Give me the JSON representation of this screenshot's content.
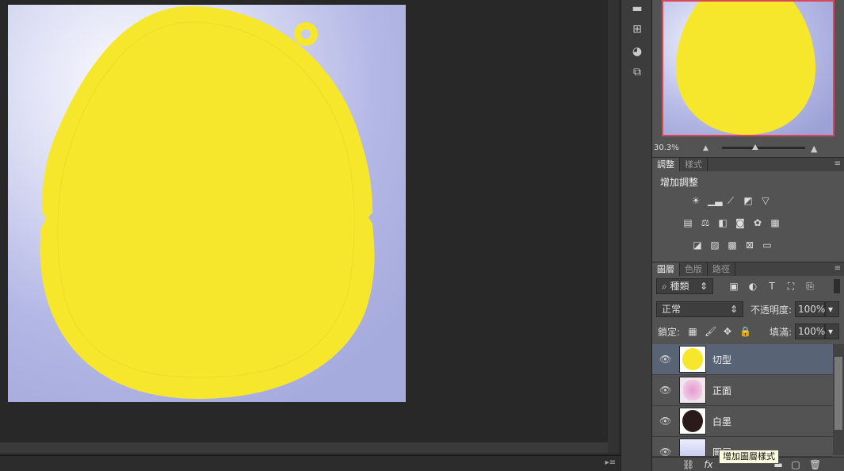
{
  "document": {
    "bg_color": "#b4b8e6",
    "shape_color": "#f6e72c"
  },
  "navigator": {
    "zoom": "30.3%",
    "frame_color": "#d9475a"
  },
  "adjustments": {
    "tabs": [
      "調整",
      "樣式"
    ],
    "title": "增加調整",
    "row1": [
      "brightness-icon",
      "levels-icon",
      "curves-icon",
      "exposure-icon",
      "vibrance-icon"
    ],
    "row2": [
      "hue-sat-icon",
      "color-balance-icon",
      "bw-icon",
      "photo-filter-icon",
      "channel-mixer-icon",
      "color-lookup-icon"
    ],
    "row3": [
      "invert-icon",
      "posterize-icon",
      "threshold-icon",
      "selective-color-icon",
      "gradient-map-icon"
    ]
  },
  "layers_panel": {
    "tabs": [
      "圖層",
      "色版",
      "路徑"
    ],
    "filter_kind": "種類",
    "blend_mode": "正常",
    "opacity_label": "不透明度:",
    "opacity_value": "100%",
    "lock_label": "鎖定:",
    "fill_label": "填滿:",
    "fill_value": "100%",
    "layers": [
      {
        "name": "切型",
        "selected": true,
        "thumb": "yellow"
      },
      {
        "name": "正面",
        "selected": false,
        "thumb": "pink"
      },
      {
        "name": "白墨",
        "selected": false,
        "thumb": "dark"
      },
      {
        "name": "圖層",
        "selected": false,
        "thumb": "bg"
      }
    ],
    "tooltip": "增加圖層樣式"
  }
}
